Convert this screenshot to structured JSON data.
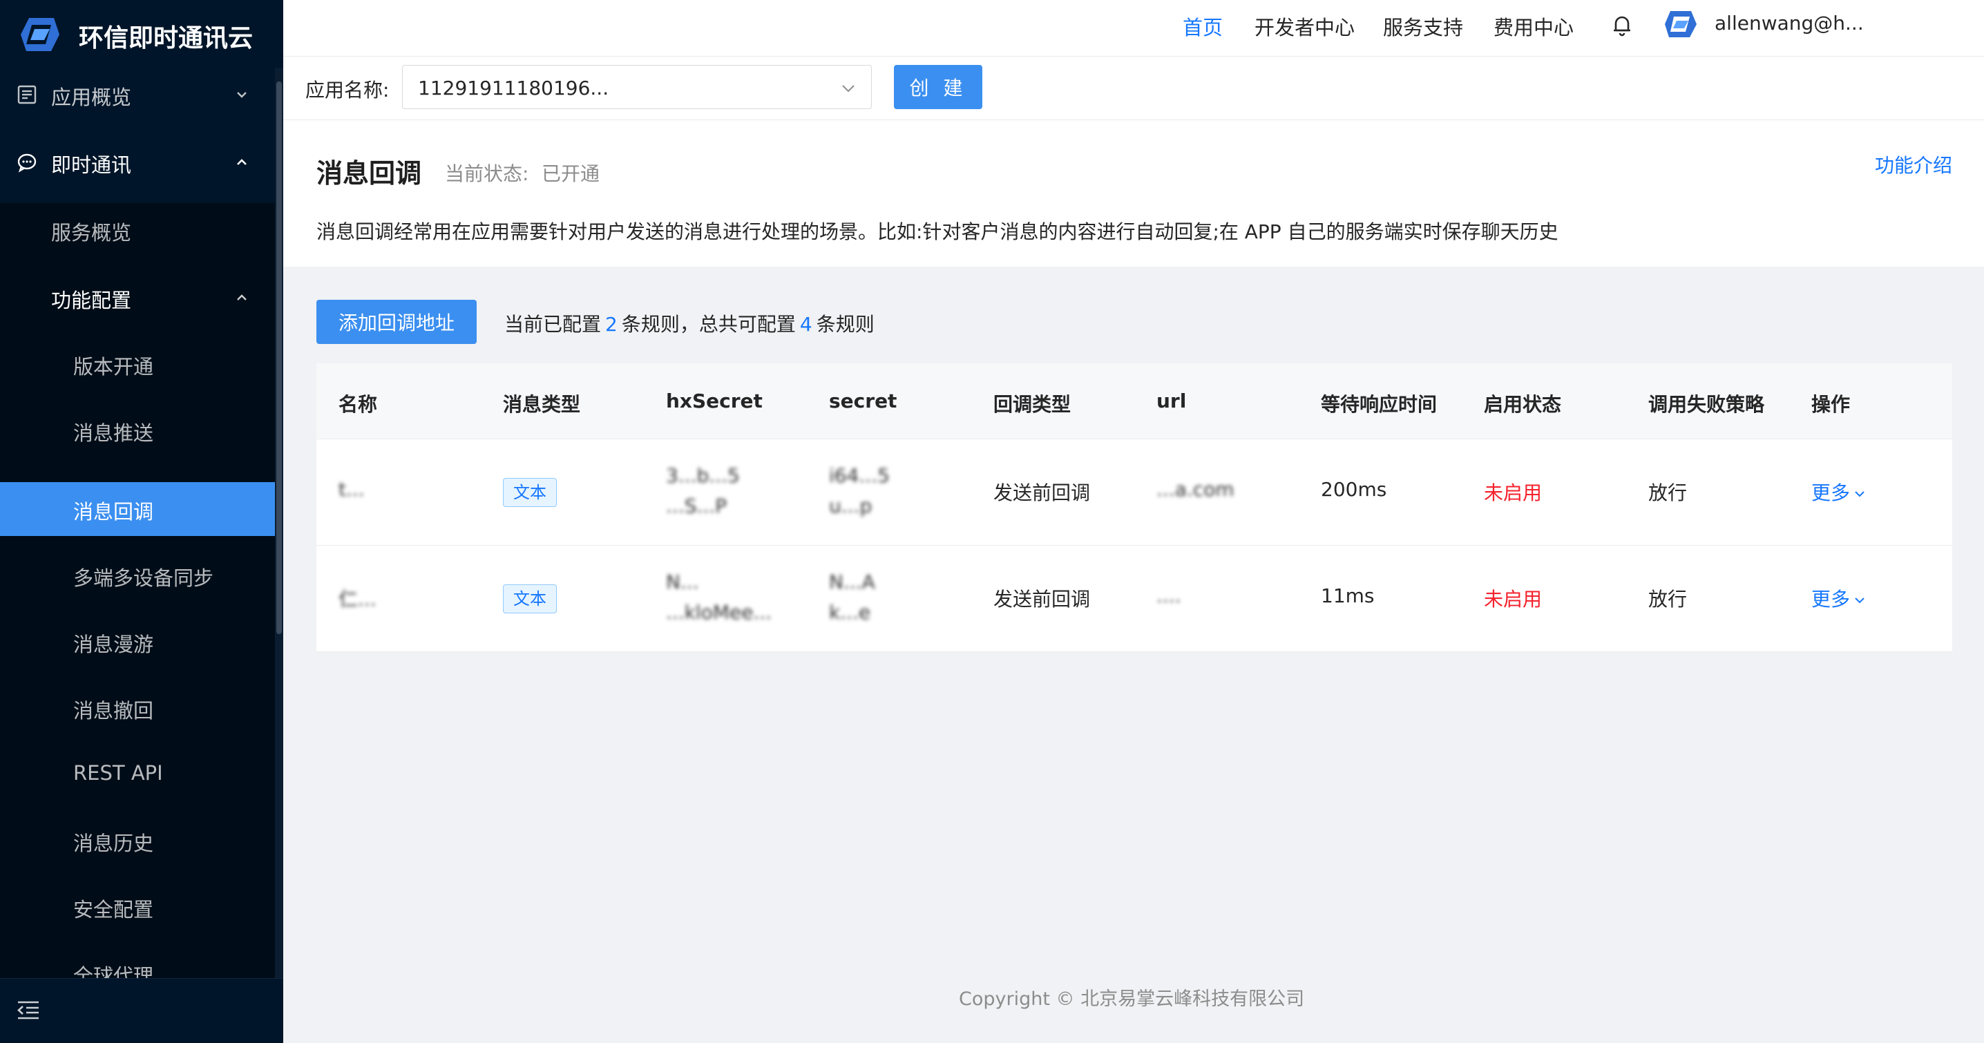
{
  "brand": {
    "title": "环信即时通讯云",
    "logo": "huanxin-logo"
  },
  "sidebar": {
    "items": [
      {
        "label": "应用概览",
        "icon": "overview-icon",
        "arrow": "chevron-down"
      },
      {
        "label": "即时通讯",
        "icon": "chat-icon",
        "arrow": "chevron-up"
      },
      {
        "label": "服务概览"
      },
      {
        "label": "功能配置",
        "arrow": "chevron-up"
      },
      {
        "label": "版本开通"
      },
      {
        "label": "消息推送"
      },
      {
        "label": "消息回调"
      },
      {
        "label": "多端多设备同步"
      },
      {
        "label": "消息漫游"
      },
      {
        "label": "消息撤回"
      },
      {
        "label": "REST API"
      },
      {
        "label": "消息历史"
      },
      {
        "label": "安全配置"
      },
      {
        "label": "全球代理"
      }
    ],
    "active_item": "消息回调",
    "footer_icon": "collapse-menu-icon"
  },
  "topbar": {
    "links": [
      "首页",
      "开发者中心",
      "服务支持",
      "费用中心"
    ],
    "active_link": "首页",
    "user_name": "allenwang@h...",
    "bell_icon": "bell-icon"
  },
  "appbar": {
    "label": "应用名称:",
    "selected_app": "11291911180196...",
    "create_label": "创 建"
  },
  "feature": {
    "title": "消息回调",
    "status_label": "当前状态:",
    "status_value": "已开通",
    "intro_link": "功能介绍",
    "description": "消息回调经常用在应用需要针对用户发送的消息进行处理的场景。比如:针对客户消息的内容进行自动回复;在 APP 自己的服务端实时保存聊天历史"
  },
  "rules": {
    "add_button": "添加回调地址",
    "count_prefix": "当前已配置",
    "configured": "2",
    "count_middle": "条规则，总共可配置",
    "total": "4",
    "count_suffix": "条规则"
  },
  "table": {
    "columns": [
      "名称",
      "消息类型",
      "hxSecret",
      "secret",
      "回调类型",
      "url",
      "等待响应时间",
      "启用状态",
      "调用失败策略",
      "操作"
    ],
    "rows": [
      {
        "name": "t...",
        "msg_type": "文本",
        "hx_secret_1": "3...b...5",
        "hx_secret_2": "...S...P",
        "secret_1": "i64...5",
        "secret_2": "u...p",
        "callback_type": "发送前回调",
        "url": "...a.com",
        "timeout": "200ms",
        "enabled": "未启用",
        "fail_policy": "放行",
        "action": "更多"
      },
      {
        "name": "仁...",
        "msg_type": "文本",
        "hx_secret_1": "N...",
        "hx_secret_2": "...kloMee...",
        "secret_1": "N...A",
        "secret_2": "k...e",
        "callback_type": "发送前回调",
        "url": "....",
        "timeout": "11ms",
        "enabled": "未启用",
        "fail_policy": "放行",
        "action": "更多"
      }
    ]
  },
  "footer": {
    "copyright": "Copyright © 北京易掌云峰科技有限公司"
  },
  "colors": {
    "sidebar_bg": "#001529",
    "primary": "#3b8ff0",
    "link": "#1677ff",
    "danger": "#f5222d"
  }
}
